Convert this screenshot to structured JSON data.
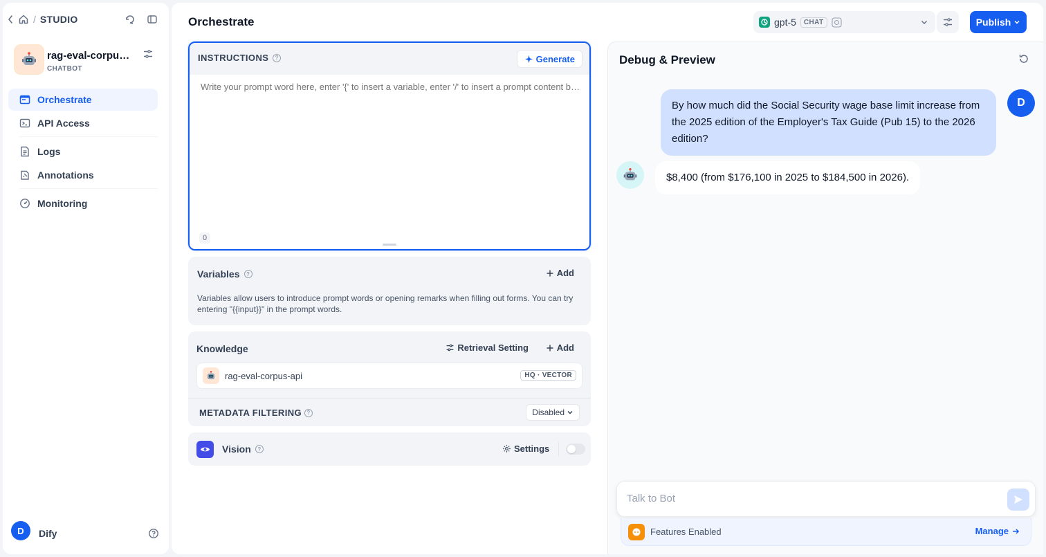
{
  "sidebar": {
    "breadcrumb": "STUDIO",
    "app_name": "rag-eval-corpus-api",
    "app_type": "CHATBOT",
    "nav": [
      {
        "label": "Orchestrate"
      },
      {
        "label": "API Access"
      },
      {
        "label": "Logs"
      },
      {
        "label": "Annotations"
      },
      {
        "label": "Monitoring"
      }
    ],
    "user_initial": "D",
    "user_name": "Dify"
  },
  "header": {
    "title": "Orchestrate",
    "model_name": "gpt-5",
    "model_mode": "CHAT",
    "publish_label": "Publish"
  },
  "instructions": {
    "label": "INSTRUCTIONS",
    "generate_label": "Generate",
    "placeholder": "Write your prompt word here, enter '{' to insert a variable, enter '/' to insert a prompt content block",
    "char_count": "0"
  },
  "variables": {
    "title": "Variables",
    "add_label": "Add",
    "description": "Variables allow users to introduce prompt words or opening remarks when filling out forms. You can try entering \"{{input}}\" in the prompt words."
  },
  "knowledge": {
    "title": "Knowledge",
    "retrieval_label": "Retrieval Setting",
    "add_label": "Add",
    "items": [
      {
        "name": "rag-eval-corpus-api",
        "badge": "HQ · VECTOR"
      }
    ],
    "metadata_label": "METADATA FILTERING",
    "metadata_value": "Disabled"
  },
  "vision": {
    "title": "Vision",
    "settings_label": "Settings",
    "enabled": false
  },
  "debug": {
    "title": "Debug & Preview",
    "messages": [
      {
        "role": "user",
        "avatar": "D",
        "text": "By how much did the Social Security wage base limit increase from the 2025 edition of the Employer's Tax Guide (Pub 15) to the 2026 edition?"
      },
      {
        "role": "bot",
        "text": "$8,400 (from $176,100 in 2025 to $184,500 in 2026)."
      }
    ],
    "input_placeholder": "Talk to Bot",
    "features_text": "Features Enabled",
    "manage_label": "Manage"
  },
  "colors": {
    "accent": "#155eef",
    "vision_icon": "#444ce7",
    "features_icon": "#f79009"
  }
}
